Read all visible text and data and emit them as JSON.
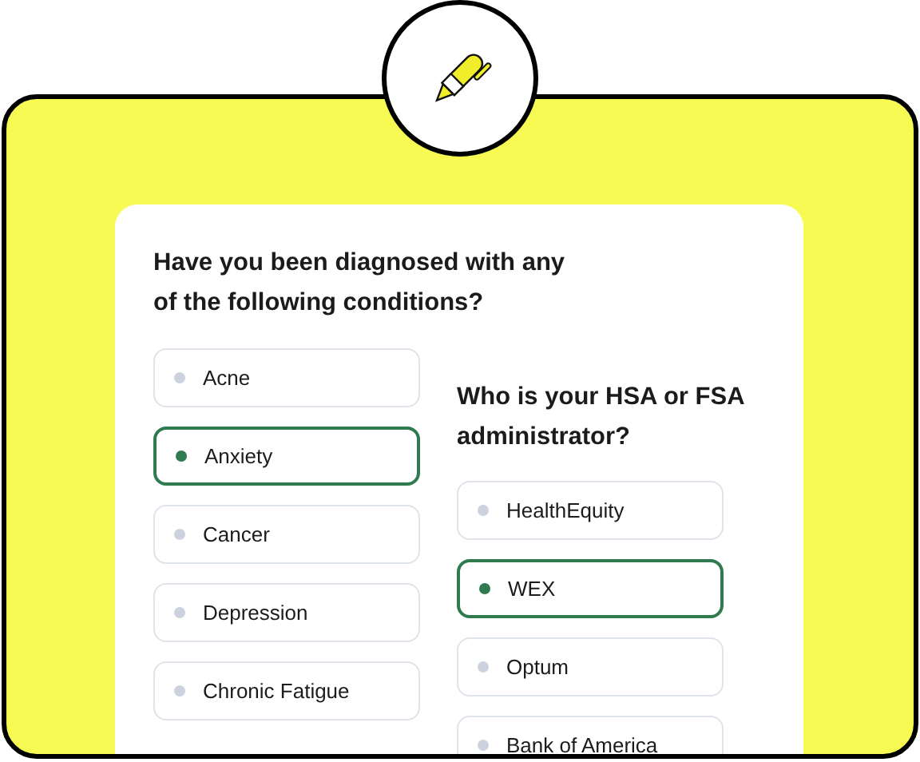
{
  "questions": [
    {
      "text": "Have you been diagnosed with any of the following conditions?",
      "options": [
        {
          "label": "Acne",
          "selected": false
        },
        {
          "label": "Anxiety",
          "selected": true
        },
        {
          "label": "Cancer",
          "selected": false
        },
        {
          "label": "Depression",
          "selected": false
        },
        {
          "label": "Chronic Fatigue",
          "selected": false
        }
      ]
    },
    {
      "text": "Who is your HSA or FSA administrator?",
      "options": [
        {
          "label": "HealthEquity",
          "selected": false
        },
        {
          "label": "WEX",
          "selected": true
        },
        {
          "label": "Optum",
          "selected": false
        },
        {
          "label": "Bank of America",
          "selected": false
        }
      ]
    }
  ]
}
